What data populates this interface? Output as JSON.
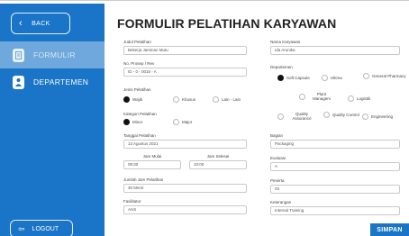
{
  "sidebar": {
    "back_label": "BACK",
    "items": [
      {
        "label": "FORMULIR",
        "icon": "document-icon",
        "active": true
      },
      {
        "label": "DEPARTEMEN",
        "icon": "people-icon",
        "active": false
      }
    ],
    "logout_label": "LOGOUT"
  },
  "form": {
    "title": "FORMULIR PELATIHAN KARYAWAN",
    "judul": {
      "label": "Judul Pelatihan",
      "value": "Bekerja Jaminan Mutu"
    },
    "nama": {
      "label": "Nama Karyawan",
      "value": "Ida Arunika"
    },
    "no": {
      "label": "No. Prosep / Rev",
      "value": "ID - 0 - 0016 - A"
    },
    "departemen_label": "Departemen",
    "departemen_options": [
      "Soft Capsule",
      "Hikma",
      "General Pharmacy",
      "Plant Managem",
      "Logistik",
      "Quality Assurance",
      "Quality Control",
      "Engineering"
    ],
    "jenis_label": "Jenis Pelatihan",
    "jenis_options": [
      "Wajib",
      "Khusus",
      "Lain - Lain"
    ],
    "kategori_label": "Kategori Pelatihan",
    "kategori_options": [
      "Minor",
      "Major"
    ],
    "tanggal": {
      "label": "Tanggal Pelatihan",
      "value": "13 Agustus 2021"
    },
    "bagian": {
      "label": "Bagian",
      "value": "Packaging"
    },
    "jam_mulai": {
      "label": "Jam Mulai",
      "value": "09:30"
    },
    "jam_selesai": {
      "label": "Jam Selesai",
      "value": "10:00"
    },
    "evaluasi": {
      "label": "Evaluasi",
      "value": "A"
    },
    "jumlah": {
      "label": "Jumlah Jam Pelatihan",
      "value": "30 Menit"
    },
    "peserta": {
      "label": "Peserta",
      "value": "03"
    },
    "fasilitator": {
      "label": "Fasilitator",
      "value": "AHS"
    },
    "keterangan": {
      "label": "Keterangan",
      "value": "Internal Training"
    },
    "save_label": "SIMPAN"
  },
  "colors": {
    "brand": "#1a74c7",
    "active_nav": "#6ea8dc"
  }
}
